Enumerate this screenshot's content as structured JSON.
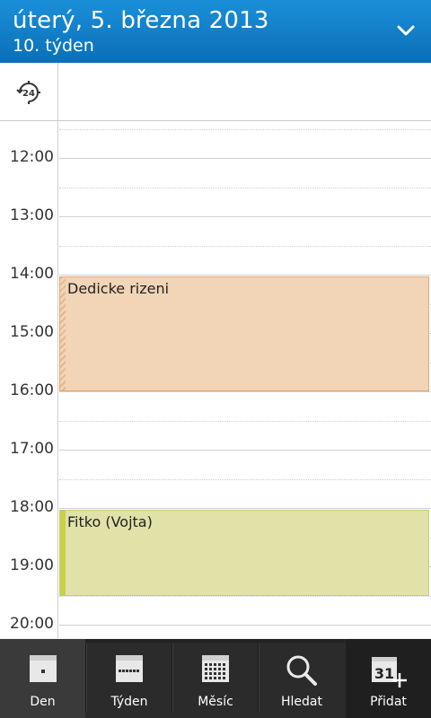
{
  "header": {
    "title": "úterý, 5. března 2013",
    "subtitle": "10. týden"
  },
  "allday": {
    "toggle_icon": "24h-clock-icon",
    "toggle_text": "24"
  },
  "hours": [
    "12:00",
    "13:00",
    "14:00",
    "15:00",
    "16:00",
    "17:00",
    "18:00",
    "19:00",
    "20:00"
  ],
  "events": [
    {
      "title": "Dedicke rizeni",
      "start": "14:00",
      "end": "16:00",
      "color": "#f2d4b7"
    },
    {
      "title": "Fitko (Vojta)",
      "start": "18:00",
      "end": "19:30",
      "color": "#e0e2a8"
    }
  ],
  "tabs": [
    {
      "label": "Den",
      "icon": "day-view-icon",
      "active": true
    },
    {
      "label": "Týden",
      "icon": "week-view-icon"
    },
    {
      "label": "Měsíc",
      "icon": "month-view-icon"
    },
    {
      "label": "Hledat",
      "icon": "search-icon"
    },
    {
      "label": "Přidat",
      "icon": "add-event-icon",
      "icon_number": "31"
    }
  ],
  "colors": {
    "header": "#0f7dc8",
    "active_tab_indicator": "#1f8fe0"
  }
}
